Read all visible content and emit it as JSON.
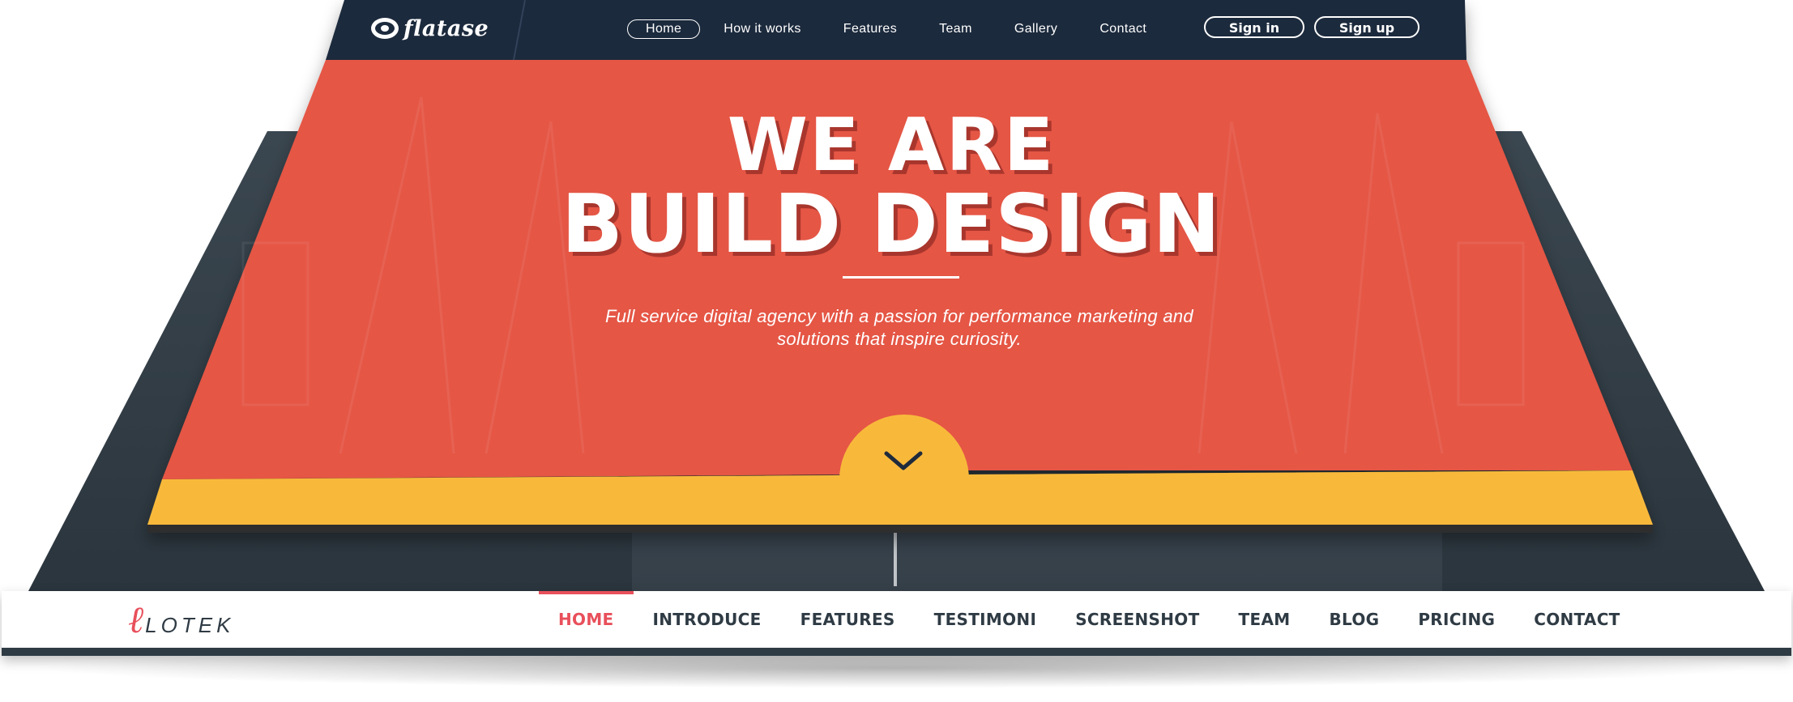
{
  "back_site": {
    "logo_mark": "ℓ",
    "logo_text": "LOTEK",
    "nav": [
      "HOME",
      "INTRODUCE",
      "FEATURES",
      "TESTIMONI",
      "SCREENSHOT",
      "TEAM",
      "BLOG",
      "PRICING",
      "CONTACT"
    ],
    "active_nav": "HOME",
    "accent_color": "#e8505b",
    "frame_color": "#2f3b44"
  },
  "front_site": {
    "logo_icon": "eye-circle-icon",
    "logo_text": "flatase",
    "nav": [
      "Home",
      "How it works",
      "Features",
      "Team",
      "Gallery",
      "Contact"
    ],
    "active_nav": "Home",
    "sign_in_label": "Sign in",
    "sign_up_label": "Sign up",
    "hero_line1": "WE ARE",
    "hero_line2": "BUILD DESIGN",
    "hero_subtitle_line1": "Full service digital agency with a passion for performance marketing and",
    "hero_subtitle_line2": "solutions that inspire curiosity.",
    "scroll_icon": "chevron-down-icon",
    "header_color": "#1f2b3c",
    "hero_color": "#e55744",
    "band_color": "#f8b93b"
  }
}
